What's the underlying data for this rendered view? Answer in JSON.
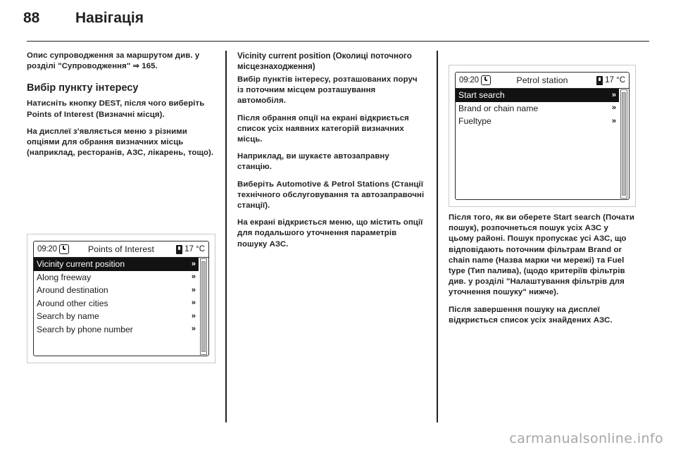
{
  "header": {
    "page_number": "88",
    "chapter_title": "Навігація"
  },
  "columns": {
    "left": {
      "intro_p1": "Опис супроводження за маршрутом див. у розділі \"Супроводження\"",
      "intro_xref": "165.",
      "section_heading": "Вибір пункту інтересу",
      "p1": "Натисніть кнопку DEST, після чого виберіть Points of Interest (Визначні місця).",
      "p2": "На дисплеї з'являється меню з різними опціями для обрання визначних місць (наприклад, ресторанів, АЗС, лікарень, тощо)."
    },
    "middle": {
      "sub_heading": "Vicinity current position (Околиці поточного місцезнаходження)",
      "p1": "Вибір пунктів інтересу, розташованих поруч із поточним місцем розташування автомобіля.",
      "p2": "Після обрання опції на екрані відкриється список усіх наявних категорій визначних місць.",
      "p3": "Наприклад, ви шукаєте автозаправну станцію.",
      "p4": "Виберіть Automotive & Petrol Stations (Станції технічного обслуговування та автозаправочні станції).",
      "p5": "На екрані відкриється меню, що містить опції для подальшого уточнення параметрів пошуку АЗС."
    },
    "right": {
      "p1": "Після того, як ви оберете Start search (Почати пошук), розпочнеться пошук усіх АЗС у цьому районі. Пошук пропускає усі АЗС, що відповідають поточним фільтрам Brand or chain name (Назва марки чи мережі) та Fuel type (Тип палива), (щодо критеріїв фільтрів див. у розділі \"Налаштування фільтрів для уточнення пошуку\" нижче).",
      "p2": "Після завершення пошуку на дисплеї відкриється список усіх знайдених АЗС."
    }
  },
  "figures": {
    "poi_screen": {
      "status": {
        "time": "09:20",
        "clock_icon": "clock-icon",
        "title": "Points of Interest",
        "temp_icon": "thermometer-icon",
        "temperature": "17 °C"
      },
      "menu_items": [
        {
          "label": "Vicinity current position",
          "selected": true,
          "chevron": "chevron-right-icon"
        },
        {
          "label": "Along freeway",
          "selected": false,
          "chevron": "chevron-right-icon"
        },
        {
          "label": "Around destination",
          "selected": false,
          "chevron": "chevron-right-icon"
        },
        {
          "label": "Around other cities",
          "selected": false,
          "chevron": "chevron-right-icon"
        },
        {
          "label": "Search by name",
          "selected": false,
          "chevron": "chevron-right-icon"
        },
        {
          "label": "Search by phone number",
          "selected": false,
          "chevron": "chevron-right-icon"
        }
      ],
      "scrollbar": {
        "thumb_top_pct": 2,
        "thumb_height_pct": 96
      }
    },
    "petrol_screen": {
      "status": {
        "time": "09:20",
        "clock_icon": "clock-icon",
        "title": "Petrol station",
        "temp_icon": "thermometer-icon",
        "temperature": "17 °C"
      },
      "menu_items": [
        {
          "label": "Start search",
          "selected": true,
          "chevron": "chevron-right-icon"
        },
        {
          "label": "Brand or chain name",
          "selected": false,
          "chevron": "chevron-right-icon"
        },
        {
          "label": "Fueltype",
          "selected": false,
          "chevron": "chevron-right-icon"
        }
      ],
      "scrollbar": {
        "thumb_top_pct": 2,
        "thumb_height_pct": 96
      }
    }
  },
  "footer": {
    "watermark": "carmanualsonline.info"
  },
  "colors": {
    "ink": "#231f20",
    "selection_bg": "#121212",
    "selection_fg": "#ffffff",
    "watermark": "#a6a6a6"
  }
}
